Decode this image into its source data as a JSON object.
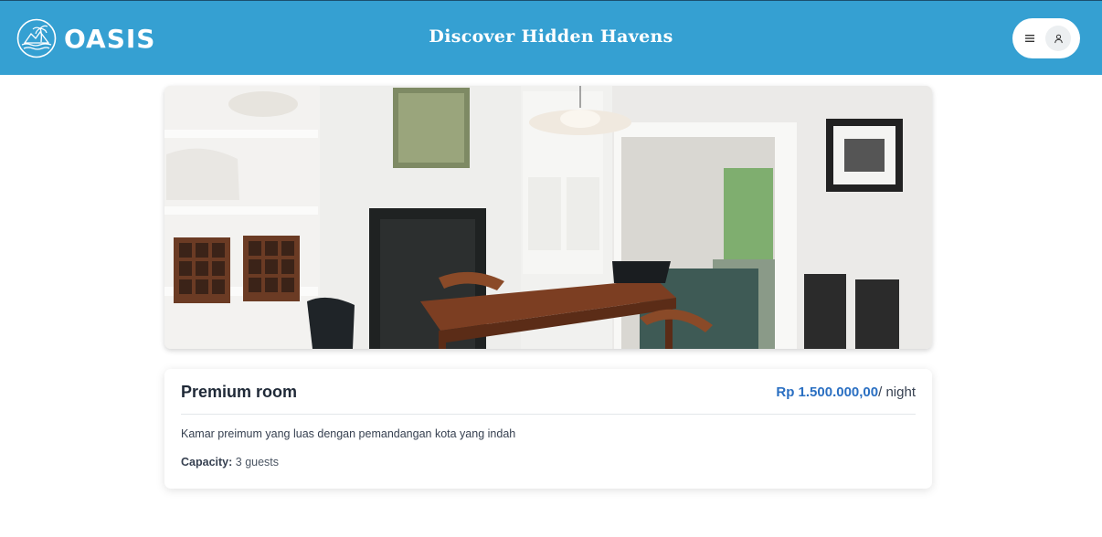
{
  "header": {
    "brand_name": "OASIS",
    "tagline": "Discover Hidden Havens",
    "logo_icon": "palm-island-icon",
    "menu_icon": "hamburger-icon",
    "user_icon": "user-icon",
    "colors": {
      "header_bg": "#35a0d2",
      "price": "#2a6fc2"
    }
  },
  "room": {
    "title": "Premium room",
    "price": "Rp 1.500.000,00",
    "price_unit": "/ night",
    "description": "Kamar preimum yang luas dengan pemandangan kota yang indah",
    "capacity_label": "Capacity:",
    "capacity_value": "3 guests"
  }
}
